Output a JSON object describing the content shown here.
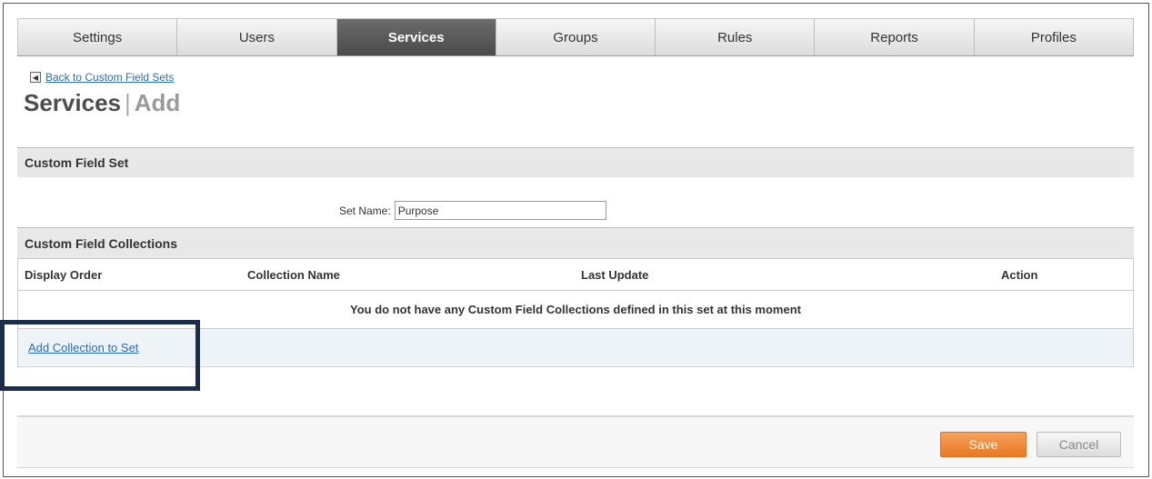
{
  "tabs": [
    {
      "label": "Settings",
      "active": false
    },
    {
      "label": "Users",
      "active": false
    },
    {
      "label": "Services",
      "active": true
    },
    {
      "label": "Groups",
      "active": false
    },
    {
      "label": "Rules",
      "active": false
    },
    {
      "label": "Reports",
      "active": false
    },
    {
      "label": "Profiles",
      "active": false
    }
  ],
  "back_link": {
    "icon": "back-arrow-icon",
    "label": "Back to Custom Field Sets"
  },
  "page_title": {
    "main": "Services",
    "separator": "|",
    "sub": "Add"
  },
  "custom_field_set": {
    "title": "Custom Field Set",
    "set_name_label": "Set Name:",
    "set_name_value": "Purpose"
  },
  "collections": {
    "title": "Custom Field Collections",
    "columns": [
      "Display Order",
      "Collection Name",
      "Last Update",
      "Action"
    ],
    "empty_message": "You do not have any Custom Field Collections defined in this set at this moment",
    "add_link": "Add Collection to Set"
  },
  "footer": {
    "save_label": "Save",
    "cancel_label": "Cancel"
  },
  "colors": {
    "active_tab": "#4a4a4a",
    "save_button": "#e87922",
    "link": "#2a6ebb",
    "highlight": "#1c2c4c"
  }
}
